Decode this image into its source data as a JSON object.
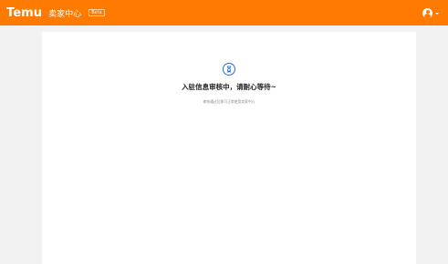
{
  "header": {
    "logo": "Temu",
    "portal_title": "卖家中心",
    "beta_badge": "Beta",
    "accent_color": "#ff7a00",
    "user_icon": "user-avatar-icon",
    "menu_icon": "chevron-down-icon"
  },
  "status": {
    "icon": "hourglass-icon",
    "icon_color": "#1f6ed4",
    "title": "入驻信息审核中，请耐心等待~",
    "subtitle": "审核通过后即可正常使用卖家中心"
  }
}
